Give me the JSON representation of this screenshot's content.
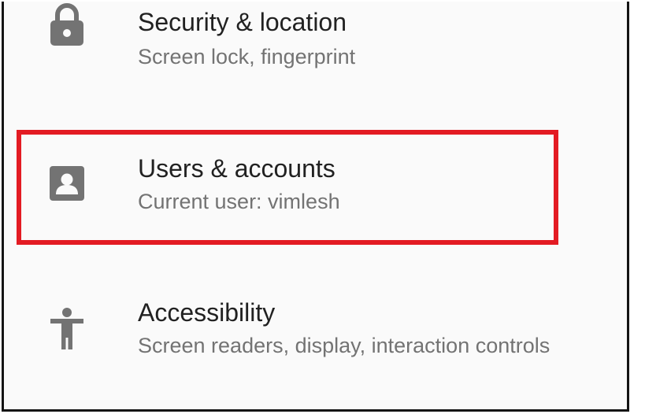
{
  "settings": {
    "items": [
      {
        "id": "security",
        "icon": "lock-icon",
        "title": "Security & location",
        "summary": "Screen lock, fingerprint"
      },
      {
        "id": "users",
        "icon": "account-box-icon",
        "title": "Users & accounts",
        "summary": "Current user: vimlesh"
      },
      {
        "id": "accessibility",
        "icon": "accessibility-icon",
        "title": "Accessibility",
        "summary": "Screen readers, display, interaction controls"
      }
    ]
  },
  "colors": {
    "background": "#fafafa",
    "title_text": "#212121",
    "summary_text": "#737373",
    "icon": "#737373",
    "highlight": "#e31b23",
    "frame_border": "#141414"
  }
}
